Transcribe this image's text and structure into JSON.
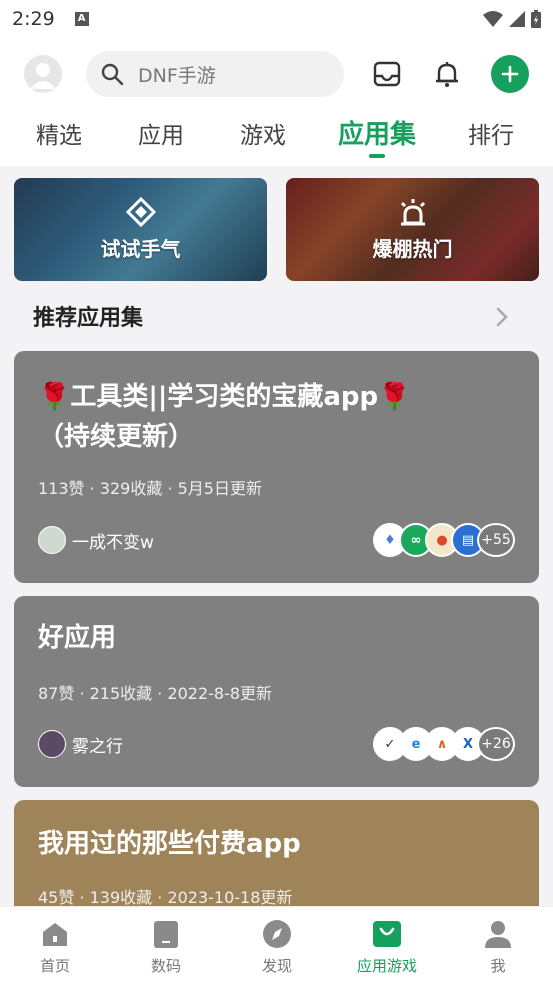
{
  "status_bar": {
    "time": "2:29",
    "notif_icon": "A"
  },
  "search": {
    "placeholder": "DNF手游"
  },
  "tabs": [
    {
      "label": "精选"
    },
    {
      "label": "应用"
    },
    {
      "label": "游戏"
    },
    {
      "label": "应用集"
    },
    {
      "label": "排行"
    }
  ],
  "active_tab": "应用集",
  "banners": [
    {
      "label": "试试手气",
      "icon": "dice-icon"
    },
    {
      "label": "爆棚热门",
      "icon": "alarm-light-icon"
    }
  ],
  "section": {
    "title": "推荐应用集"
  },
  "cards": [
    {
      "title_line1": "🌹工具类||学习类的宝藏app🌹",
      "title_line2": "（持续更新）",
      "meta": "113赞 · 329收藏 · 5月5日更新",
      "author": "一成不变w",
      "more": "+55",
      "bg": "#808080"
    },
    {
      "title_line1": "好应用",
      "meta": "87赞 · 215收藏 · 2022-8-8更新",
      "author": "雾之行",
      "more": "+26",
      "bg": "#808080"
    },
    {
      "title_line1": "我用过的那些付费app",
      "meta": "45赞 · 139收藏 · 2023-10-18更新",
      "bg": "#9e8458"
    }
  ],
  "bottom_nav": [
    {
      "label": "首页",
      "icon": "home-icon"
    },
    {
      "label": "数码",
      "icon": "phone-icon"
    },
    {
      "label": "发现",
      "icon": "compass-icon"
    },
    {
      "label": "应用游戏",
      "icon": "bag-icon"
    },
    {
      "label": "我",
      "icon": "person-icon"
    }
  ],
  "colors": {
    "accent": "#16a05d",
    "card_gray": "#808080",
    "card_gold": "#9e8458"
  }
}
